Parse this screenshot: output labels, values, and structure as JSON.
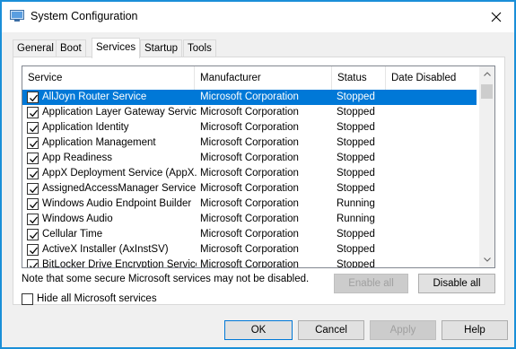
{
  "window": {
    "title": "System Configuration"
  },
  "tabs": [
    {
      "label": "General"
    },
    {
      "label": "Boot"
    },
    {
      "label": "Services"
    },
    {
      "label": "Startup"
    },
    {
      "label": "Tools"
    }
  ],
  "active_tab": "Services",
  "columns": {
    "service": "Service",
    "manufacturer": "Manufacturer",
    "status": "Status",
    "date_disabled": "Date Disabled"
  },
  "services": [
    {
      "service": "AllJoyn Router Service",
      "manufacturer": "Microsoft Corporation",
      "status": "Stopped",
      "date_disabled": "",
      "checked": true,
      "selected": true
    },
    {
      "service": "Application Layer Gateway Service",
      "manufacturer": "Microsoft Corporation",
      "status": "Stopped",
      "date_disabled": "",
      "checked": true
    },
    {
      "service": "Application Identity",
      "manufacturer": "Microsoft Corporation",
      "status": "Stopped",
      "date_disabled": "",
      "checked": true
    },
    {
      "service": "Application Management",
      "manufacturer": "Microsoft Corporation",
      "status": "Stopped",
      "date_disabled": "",
      "checked": true
    },
    {
      "service": "App Readiness",
      "manufacturer": "Microsoft Corporation",
      "status": "Stopped",
      "date_disabled": "",
      "checked": true
    },
    {
      "service": "AppX Deployment Service (AppX...",
      "manufacturer": "Microsoft Corporation",
      "status": "Stopped",
      "date_disabled": "",
      "checked": true
    },
    {
      "service": "AssignedAccessManager Service",
      "manufacturer": "Microsoft Corporation",
      "status": "Stopped",
      "date_disabled": "",
      "checked": true
    },
    {
      "service": "Windows Audio Endpoint Builder",
      "manufacturer": "Microsoft Corporation",
      "status": "Running",
      "date_disabled": "",
      "checked": true
    },
    {
      "service": "Windows Audio",
      "manufacturer": "Microsoft Corporation",
      "status": "Running",
      "date_disabled": "",
      "checked": true
    },
    {
      "service": "Cellular Time",
      "manufacturer": "Microsoft Corporation",
      "status": "Stopped",
      "date_disabled": "",
      "checked": true
    },
    {
      "service": "ActiveX Installer (AxInstSV)",
      "manufacturer": "Microsoft Corporation",
      "status": "Stopped",
      "date_disabled": "",
      "checked": true
    },
    {
      "service": "BitLocker Drive Encryption Service",
      "manufacturer": "Microsoft Corporation",
      "status": "Stopped",
      "date_disabled": "",
      "checked": true
    }
  ],
  "note": "Note that some secure Microsoft services may not be disabled.",
  "buttons": {
    "enable_all": "Enable all",
    "disable_all": "Disable all",
    "ok": "OK",
    "cancel": "Cancel",
    "apply": "Apply",
    "help": "Help"
  },
  "hide_ms": {
    "label": "Hide all Microsoft services",
    "checked": false
  },
  "colors": {
    "accent": "#0078d7",
    "window_border": "#1a8fd8"
  }
}
